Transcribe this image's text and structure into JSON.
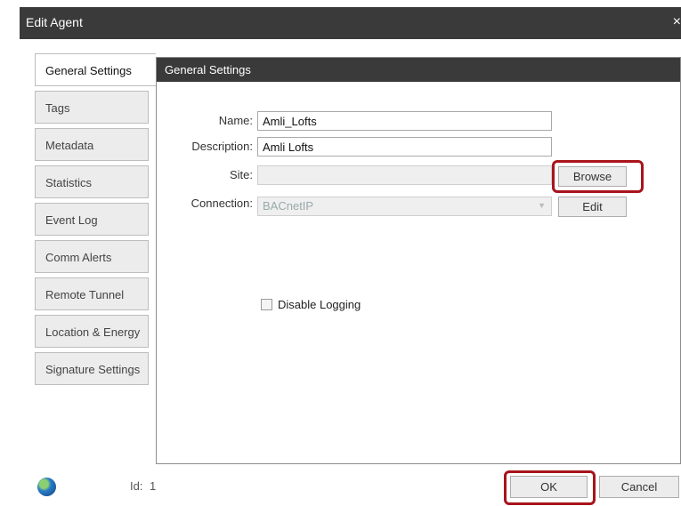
{
  "window": {
    "title": "Edit Agent",
    "close_label": "×"
  },
  "tabs": [
    {
      "label": "General Settings"
    },
    {
      "label": "Tags"
    },
    {
      "label": "Metadata"
    },
    {
      "label": "Statistics"
    },
    {
      "label": "Event Log"
    },
    {
      "label": "Comm Alerts"
    },
    {
      "label": "Remote Tunnel"
    },
    {
      "label": "Location & Energy"
    },
    {
      "label": "Signature Settings"
    }
  ],
  "panel": {
    "title": "General Settings",
    "name_label": "Name:",
    "name_value": "Amli_Lofts",
    "description_label": "Description:",
    "description_value": "Amli Lofts",
    "site_label": "Site:",
    "site_value": "",
    "browse_label": "Browse",
    "connection_label": "Connection:",
    "connection_value": "BACnetIP",
    "edit_label": "Edit",
    "disable_logging_label": "Disable Logging"
  },
  "footer": {
    "id_label": "Id:",
    "id_value": "1",
    "ok_label": "OK",
    "cancel_label": "Cancel"
  },
  "colors": {
    "titlebar": "#3a3a3a",
    "highlight": "#a8141c"
  }
}
